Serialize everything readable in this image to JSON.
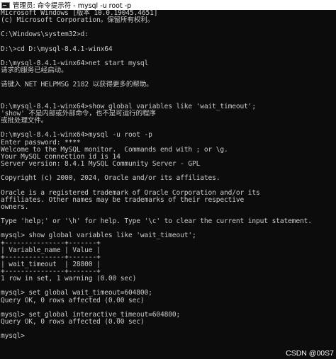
{
  "window": {
    "title": "管理员: 命令提示符 - mysql  -u root -p",
    "icon": "cmd-icon"
  },
  "console_lines": [
    "Microsoft Windows [版本 10.0.19045.4651]",
    "(c) Microsoft Corporation。保留所有权利。",
    "",
    "C:\\Windows\\system32>d:",
    "",
    "D:\\>cd D:\\mysql-8.4.1-winx64",
    "",
    "D:\\mysql-8.4.1-winx64>net start mysql",
    "请求的服务已经启动。",
    "",
    "请键入 NET HELPMSG 2182 以获得更多的帮助。",
    "",
    "",
    "D:\\mysql-8.4.1-winx64>show global variables like 'wait_timeout';",
    "'show' 不是内部或外部命令，也不是可运行的程序",
    "或批处理文件。",
    "",
    "D:\\mysql-8.4.1-winx64>mysql -u root -p",
    "Enter password: ****",
    "Welcome to the MySQL monitor.  Commands end with ; or \\g.",
    "Your MySQL connection id is 14",
    "Server version: 8.4.1 MySQL Community Server - GPL",
    "",
    "Copyright (c) 2000, 2024, Oracle and/or its affiliates.",
    "",
    "Oracle is a registered trademark of Oracle Corporation and/or its",
    "affiliates. Other names may be trademarks of their respective",
    "owners.",
    "",
    "Type 'help;' or '\\h' for help. Type '\\c' to clear the current input statement.",
    "",
    "mysql> show global variables like 'wait_timeout';",
    "+---------------+-------+",
    "| Variable_name | Value |",
    "+---------------+-------+",
    "| wait_timeout  | 28800 |",
    "+---------------+-------+",
    "1 row in set, 1 warning (0.00 sec)",
    "",
    "mysql> set global wait_timeout=604800;",
    "Query OK, 0 rows affected (0.00 sec)",
    "",
    "mysql> set global interactive_timeout=604800;",
    "Query OK, 0 rows affected (0.00 sec)",
    "",
    "mysql>"
  ],
  "watermark": "CSDN @00S7",
  "colors": {
    "background": "#0c0c0c",
    "text": "#cccccc",
    "titlebar": "#ffffff"
  }
}
